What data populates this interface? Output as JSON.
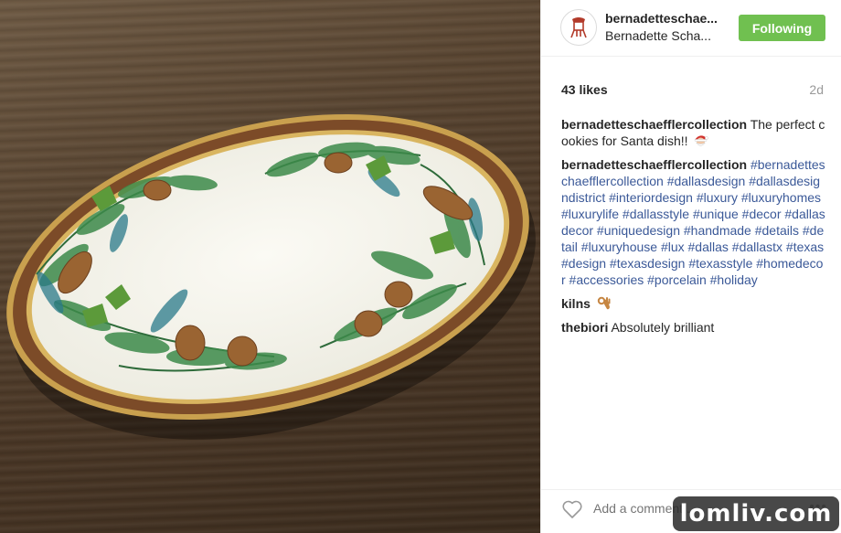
{
  "post": {
    "username": "bernadetteschae...",
    "full_name": "Bernadette Scha...",
    "follow_label": "Following",
    "likes": "43 likes",
    "time_ago": "2d"
  },
  "comments": [
    {
      "user": "bernadetteschaefflercollection",
      "text": "The perfect cookies for Santa dish!!",
      "emoji": "santa-emoji"
    },
    {
      "user": "bernadetteschaefflercollection",
      "text": "#bernadetteschaefflercollection #dallasdesign #dallasdesigndistrict #interiordesign #luxury #luxuryhomes #luxurylife #dallasstyle #unique #decor #dallasdecor #uniquedesign #handmade #details #detail #luxuryhouse #lux #dallas #dallastx #texas #design #texasdesign #texasstyle #homedecor #accessories #porcelain #holiday"
    },
    {
      "user": "kilns",
      "text": "",
      "emoji": "ok-hand-emoji"
    },
    {
      "user": "thebiori",
      "text": "Absolutely brilliant"
    }
  ],
  "footer": {
    "add_comment_placeholder": "Add a comment...",
    "more_label": "•••"
  },
  "watermark": "lomliv.com",
  "colors": {
    "follow_button": "#70c050",
    "hashtag": "#3b5998",
    "muted": "#999999"
  }
}
